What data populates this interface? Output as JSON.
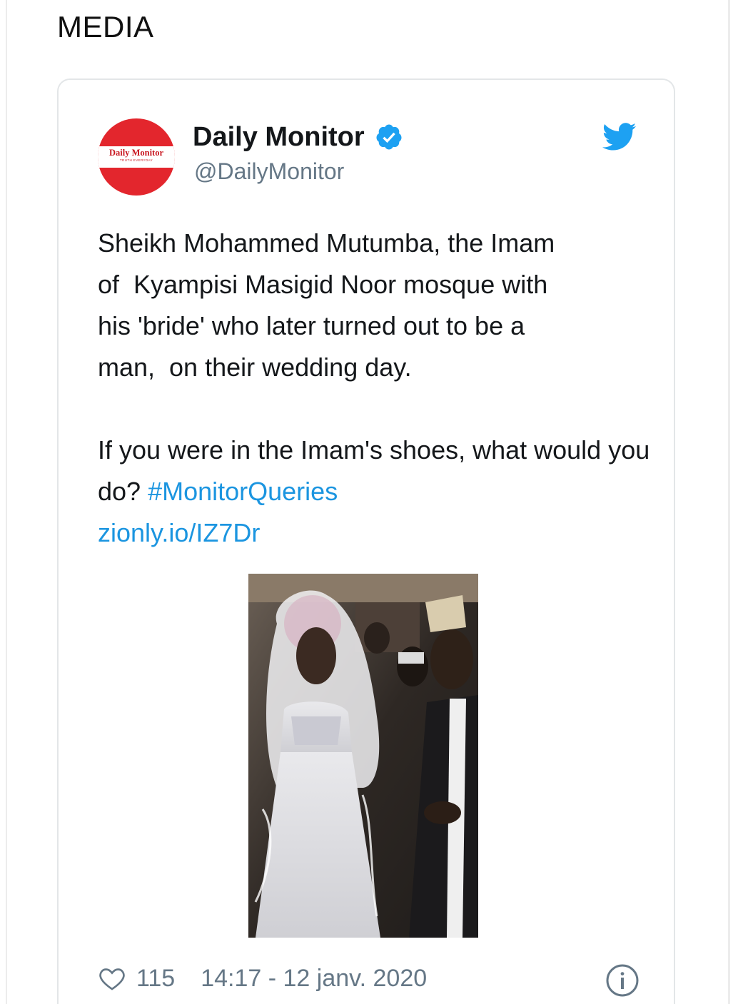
{
  "section_title": "MEDIA",
  "tweet": {
    "display_name": "Daily Monitor",
    "handle": "@DailyMonitor",
    "avatar_text": "Daily Monitor",
    "avatar_sub": "TRUTH EVERYDAY",
    "verified": true,
    "body_para1": "Sheikh Mohammed Mutumba, the Imam\nof  Kyampisi Masigid Noor mosque with\nhis 'bride' who later turned out to be a\nman,  on their wedding day.",
    "body_para2_prefix": "If you were in the Imam's shoes, what would you do? ",
    "hashtag": "#MonitorQueries",
    "short_link": "zionly.io/IZ7Dr",
    "likes": "115",
    "timestamp": "14:17 - 12 janv. 2020"
  },
  "icons": {
    "verified": "verified-badge-icon",
    "bird": "twitter-bird-icon",
    "heart": "heart-icon",
    "info": "info-icon"
  },
  "colors": {
    "accent": "#1b95e0",
    "brand_red": "#e3262d",
    "text": "#14171a",
    "muted": "#657786"
  }
}
